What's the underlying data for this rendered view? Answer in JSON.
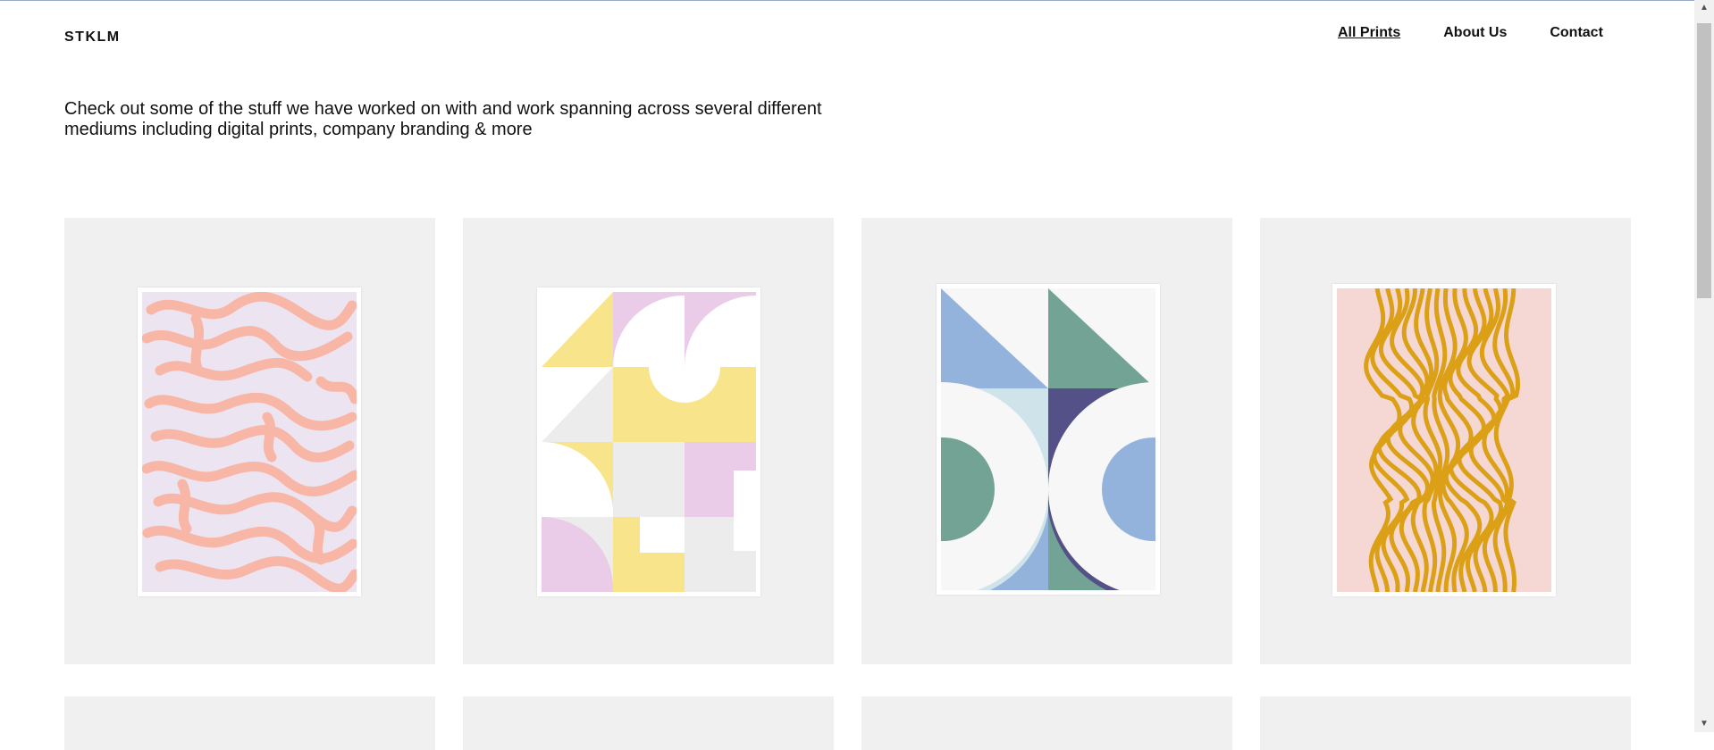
{
  "site": {
    "logo": "STKLM"
  },
  "nav": {
    "items": [
      {
        "label": "All Prints",
        "active": true
      },
      {
        "label": "About Us",
        "active": false
      },
      {
        "label": "Contact",
        "active": false
      }
    ]
  },
  "intro": {
    "text": "Check out some of the stuff we have worked on with and work spanning across several different mediums including digital prints, company branding & more"
  },
  "gallery": {
    "prints": [
      {
        "art": "pink-organic-maze-print"
      },
      {
        "art": "pastel-geometric-tiles-print"
      },
      {
        "art": "blue-green-geometric-shapes-print"
      },
      {
        "art": "mustard-wavy-lines-print"
      }
    ]
  },
  "colors": {
    "card_bg": "#f0f0f0",
    "coral": "#f8b6a6",
    "lavender": "#ece4f1",
    "yellow": "#f8e58b",
    "pink": "#eacce9",
    "blue": "#93b3dd",
    "green": "#72a394",
    "navy": "#545189",
    "mustard": "#dba016"
  },
  "scrollbar": {
    "up_icon": "▲",
    "down_icon": "▼"
  }
}
